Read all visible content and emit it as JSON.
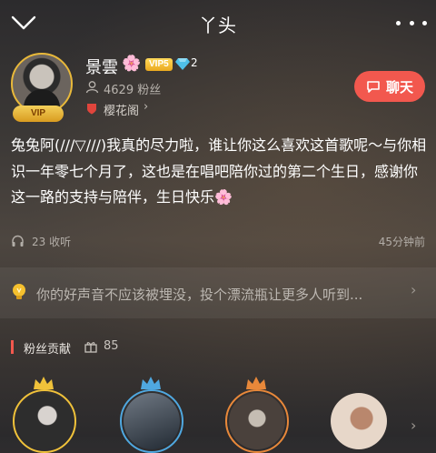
{
  "header": {
    "title": "丫头"
  },
  "profile": {
    "username": "景雲",
    "username_emoji": "🌸",
    "vip_level": "VIP5",
    "diamond_level": "2",
    "avatar_badge": "VIP",
    "fans": "4629 粉丝",
    "tag": "樱花阁",
    "chat_label": "聊天"
  },
  "post": {
    "text": "兔兔阿(///▽///)我真的尽力啦，谁让你这么喜欢这首歌呢～与你相识一年零七个月了，这也是在唱吧陪你过的第二个生日，感谢你这一路的支持与陪伴，生日快乐🌸",
    "listens": "23 收听",
    "time": "45分钟前"
  },
  "bottle": {
    "text": "你的好声音不应该被埋没，投个漂流瓶让更多人听到..."
  },
  "contributions": {
    "title": "粉丝贡献",
    "count": "85",
    "colors": {
      "gold": "#f0c23a",
      "blue": "#4fa8e0",
      "bronze": "#e8883a",
      "accent": "#f2584e"
    }
  }
}
